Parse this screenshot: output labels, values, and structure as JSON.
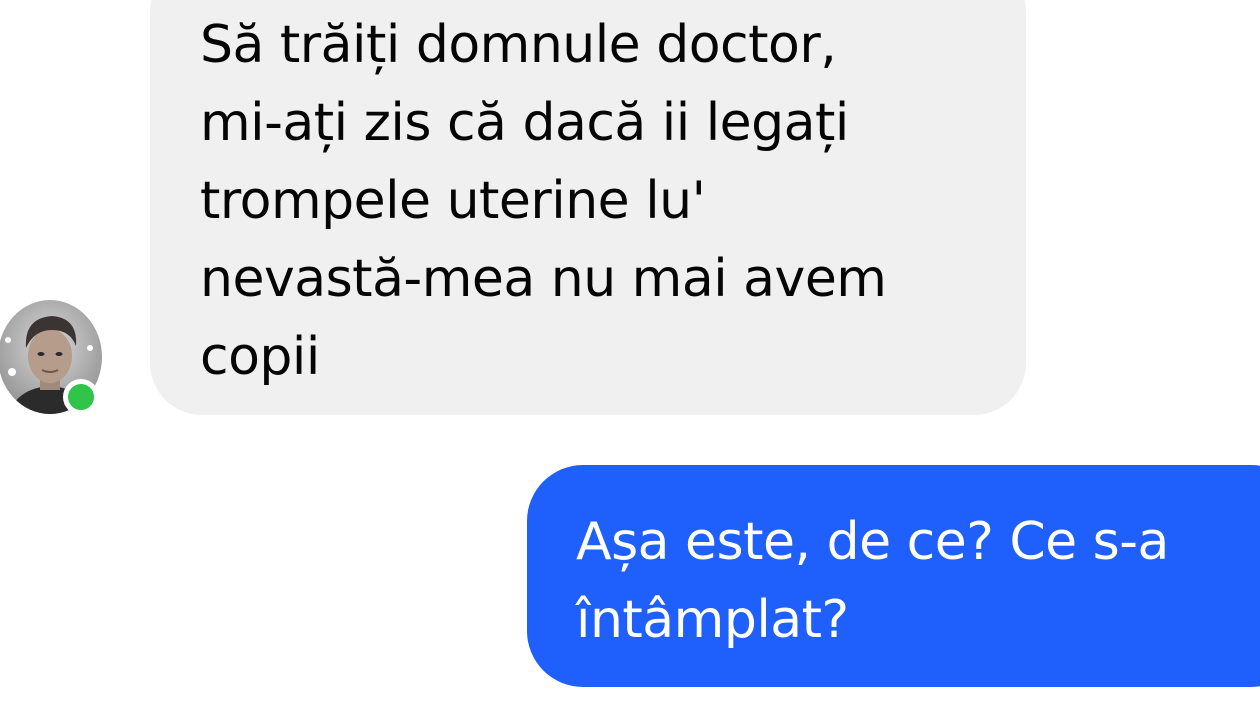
{
  "conversation": {
    "incoming": {
      "lines": [
        "Să trăiți domnule doctor,",
        "mi-ați zis că dacă ii legați",
        "trompele uterine lu'",
        "nevastă-mea nu mai avem",
        "copii"
      ],
      "bubble_color": "#f0f0f0",
      "text_color": "#050505"
    },
    "outgoing": {
      "lines": [
        "Așa este, de ce? Ce s-a",
        "întâmplat?"
      ],
      "bubble_color": "#1f5ffb",
      "text_color": "#ffffff"
    },
    "sender_avatar": {
      "icon": "user-photo-avatar",
      "online_status_color": "#31c44a"
    }
  }
}
